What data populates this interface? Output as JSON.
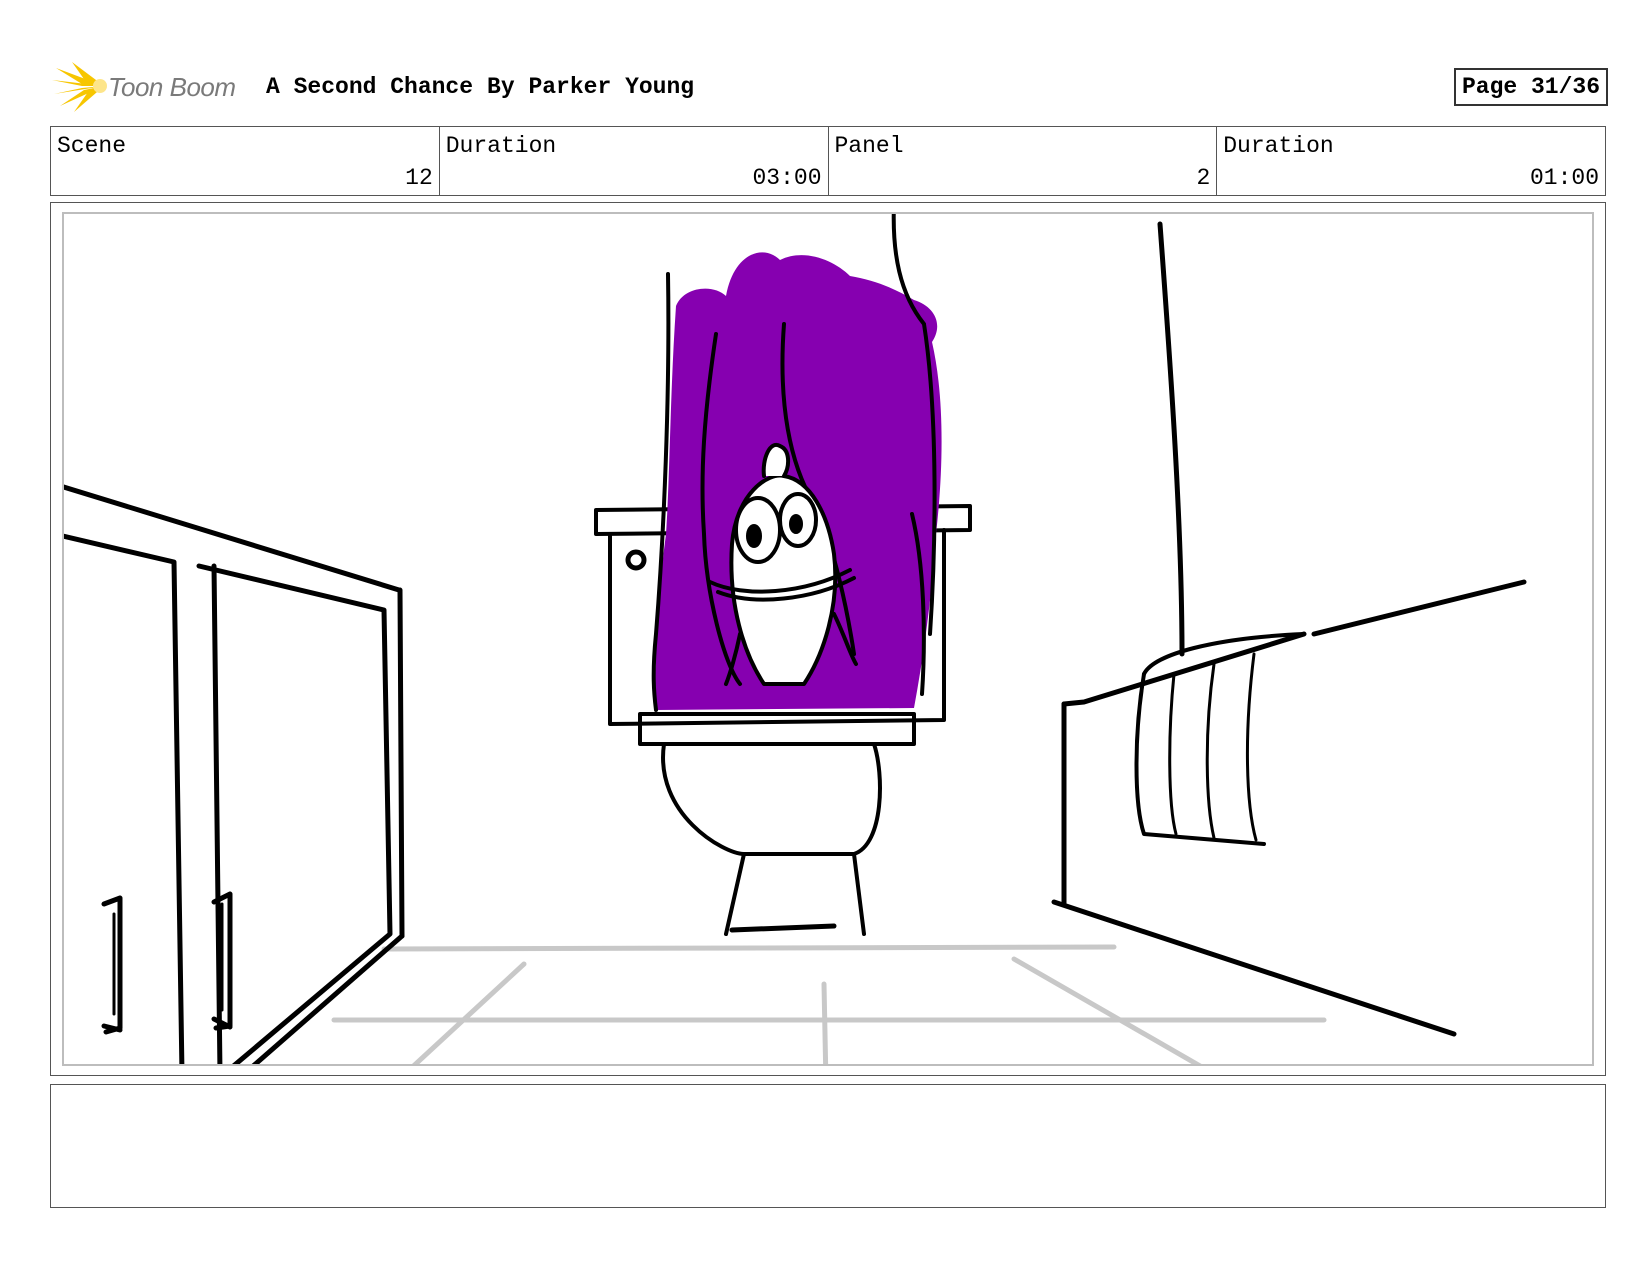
{
  "header": {
    "logo_text": "Toon Boom",
    "title": "A Second Chance",
    "author": "By Parker Young",
    "page": "Page 31/36"
  },
  "info": {
    "scene_label": "Scene",
    "scene_value": "12",
    "scene_duration_label": "Duration",
    "scene_duration_value": "03:00",
    "panel_label": "Panel",
    "panel_value": "2",
    "panel_duration_label": "Duration",
    "panel_duration_value": "01:00"
  },
  "colors": {
    "curtain": "#8600b0",
    "logo_yellow": "#f7c600",
    "frame_gray": "#bdbdbd"
  },
  "notes": ""
}
